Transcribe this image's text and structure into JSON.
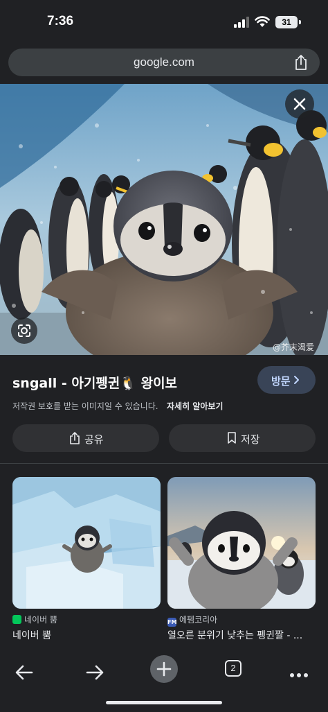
{
  "status_bar": {
    "time": "7:36",
    "battery": "31"
  },
  "browser": {
    "url": "google.com"
  },
  "image_viewer": {
    "watermark": "@芥末渴爱",
    "title": "sngall - 아기펭귄🐧 왕이보",
    "visit_label": "방문",
    "copyright_notice": "저작권 보호를 받는 이미지일 수 있습니다.",
    "learn_more": "자세히 알아보기",
    "share_label": "공유",
    "save_label": "저장"
  },
  "related": [
    {
      "source": "네이버 뿜",
      "caption": "네이버 뿜",
      "favicon_color": "#03c75a"
    },
    {
      "source": "에펨코리아",
      "caption": "열오른 분위기 낮추는 펭귄짤 - ...",
      "favicon_color": "#3b5bb5",
      "favicon_text": "FM"
    }
  ],
  "bottom_bar": {
    "tab_count": "2"
  }
}
